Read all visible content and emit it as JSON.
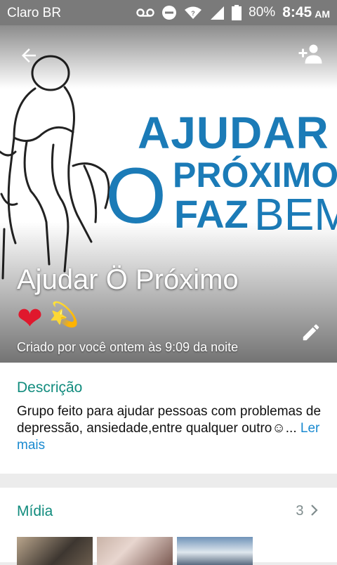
{
  "status_bar": {
    "carrier": "Claro BR",
    "battery": "80%",
    "time": "8:45",
    "ampm": "AM"
  },
  "hero": {
    "logo_line1": "AJUDAR",
    "logo_o": "O",
    "logo_line2": "PRÓXIMO",
    "logo_line3_a": "FAZ",
    "logo_line3_b": "BEM",
    "group_name": "Ajudar Ö Próximo",
    "emoji_heart": "❤",
    "emoji_spark": "💫",
    "created_text": "Criado por você ontem às 9:09 da noite"
  },
  "description": {
    "title": "Descrição",
    "text": "Grupo feito para ajudar pessoas com problemas de depressão, ansiedade,entre qualquer outro☺...",
    "read_more": "Ler mais"
  },
  "media": {
    "title": "Mídia",
    "count": "3"
  },
  "colors": {
    "accent": "#128c7e",
    "link": "#1a8ad0",
    "logo_blue": "#1b7bb7"
  }
}
